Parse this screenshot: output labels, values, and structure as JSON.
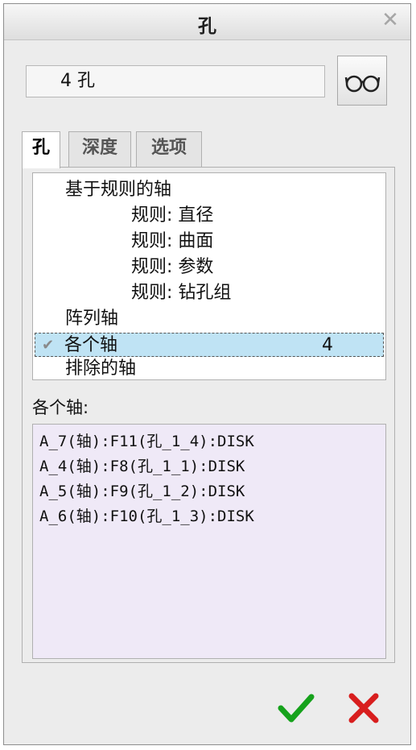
{
  "window": {
    "title": "孔",
    "close_icon": "close-icon"
  },
  "hole_name": {
    "value": "4 孔"
  },
  "preview": {
    "icon": "glasses-icon"
  },
  "tabs": [
    {
      "label": "孔",
      "active": true
    },
    {
      "label": "深度",
      "active": false
    },
    {
      "label": "选项",
      "active": false
    }
  ],
  "axes_tree": {
    "items": [
      {
        "label": "基于规则的轴",
        "level": 0
      },
      {
        "label": "规则: 直径",
        "level": 1
      },
      {
        "label": "规则: 曲面",
        "level": 1
      },
      {
        "label": "规则: 参数",
        "level": 1
      },
      {
        "label": "规则: 钻孔组",
        "level": 1
      },
      {
        "label": "阵列轴",
        "level": 0
      },
      {
        "label": "各个轴",
        "level": 0,
        "selected": true,
        "checked": true,
        "count": "4"
      },
      {
        "label": "排除的轴",
        "level": 0
      }
    ]
  },
  "individual_axes": {
    "label": "各个轴:",
    "rows": [
      "A_7(轴):F11(孔_1_4):DISK",
      "A_4(轴):F8(孔_1_1):DISK",
      "A_5(轴):F9(孔_1_2):DISK",
      "A_6(轴):F10(孔_1_3):DISK"
    ]
  },
  "footer": {
    "ok_icon": "checkmark-icon",
    "cancel_icon": "x-icon"
  },
  "colors": {
    "ok": "#16a21c",
    "cancel": "#d81e1e",
    "selected_row": "#bfe3f4",
    "list_bg": "#efe9f7"
  }
}
